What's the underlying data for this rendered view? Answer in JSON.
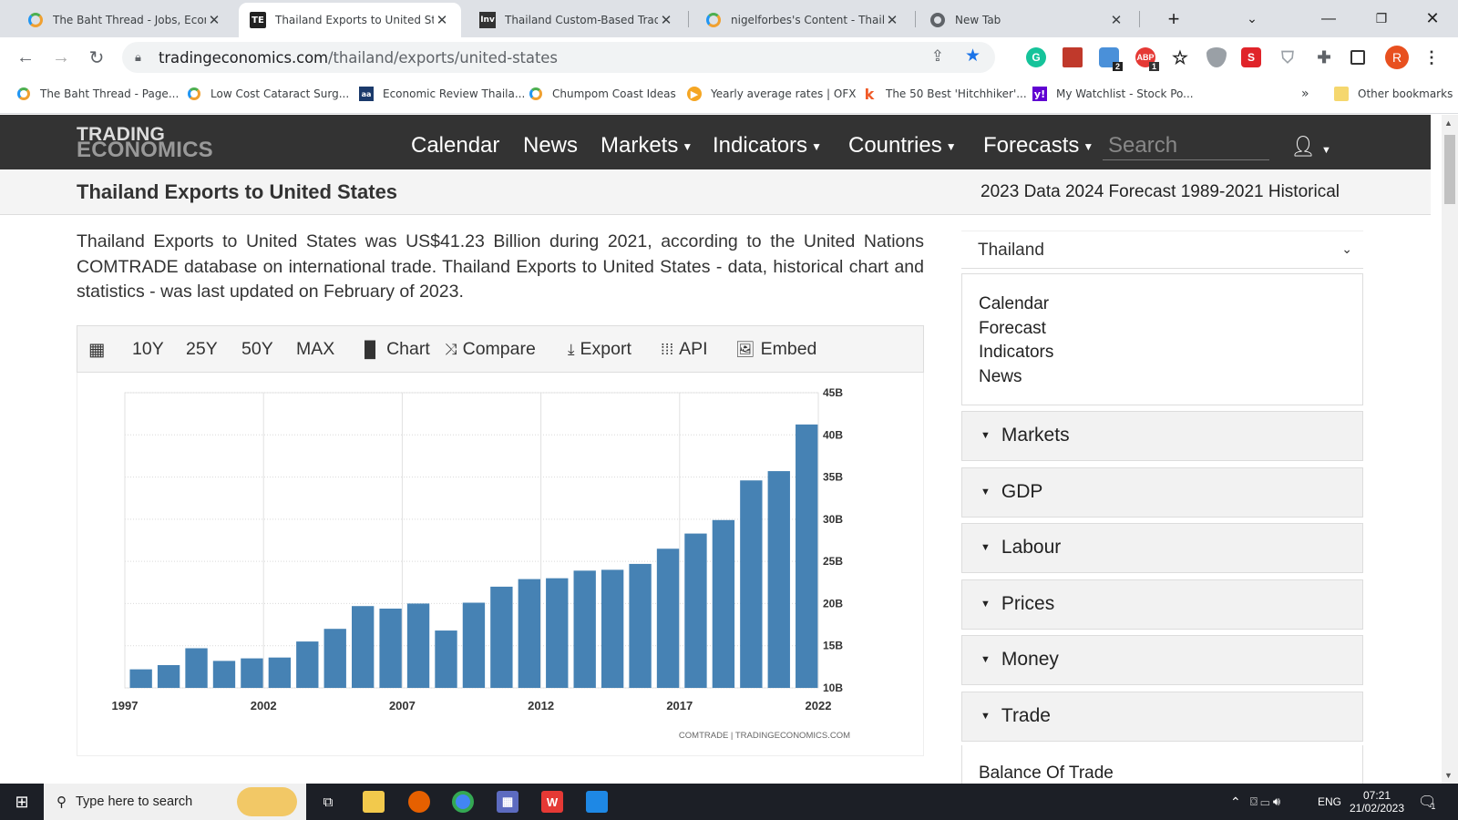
{
  "browser": {
    "tabs": [
      {
        "title": "The Baht Thread - Jobs, Econon",
        "icon": "ring-icon"
      },
      {
        "title": "Thailand Exports to United State",
        "icon": "te-icon"
      },
      {
        "title": "Thailand Custom-Based Trade D",
        "icon": "inv-icon"
      },
      {
        "title": "nigelforbes's Content - Thailand",
        "icon": "ring-icon"
      },
      {
        "title": "New Tab",
        "icon": "chrome-icon"
      }
    ],
    "url_domain": "tradingeconomics.com",
    "url_path": "/thailand/exports/united-states",
    "bookmarks": [
      "The Baht Thread - Page...",
      "Low Cost Cataract Surg...",
      "Economic Review Thaila...",
      "Chumpom Coast Ideas",
      "Yearly average rates | OFX",
      "The 50 Best 'Hitchhiker'...",
      "My Watchlist - Stock Po..."
    ],
    "other_bookmarks": "Other bookmarks",
    "more": "»",
    "profile_initial": "R",
    "badge_1": "2",
    "badge_2": "1",
    "adblock_label": "ABP"
  },
  "site": {
    "logo_line1": "TRADING",
    "logo_line2": "ECONOMICS",
    "nav": [
      "Calendar",
      "News",
      "Markets",
      "Indicators",
      "Countries",
      "Forecasts"
    ],
    "search_placeholder": "Search",
    "page_title": "Thailand Exports to United States",
    "sub_links": "2023 Data 2024 Forecast 1989-2021 Historical",
    "description": "Thailand Exports to United States was US$41.23 Billion during 2021, according to the United Nations COMTRADE database on international trade. Thailand Exports to United States - data, historical chart and statistics - was last updated on February of 2023.",
    "chart_toolbar": [
      "10Y",
      "25Y",
      "50Y",
      "MAX",
      "Chart",
      "Compare",
      "Export",
      "API",
      "Embed"
    ],
    "source_text": "COMTRADE | TRADINGECONOMICS.COM"
  },
  "sidebar": {
    "country": "Thailand",
    "links": [
      "Calendar",
      "Forecast",
      "Indicators",
      "News"
    ],
    "sections": [
      "Markets",
      "GDP",
      "Labour",
      "Prices",
      "Money",
      "Trade"
    ],
    "bottom_link": "Balance Of Trade"
  },
  "taskbar": {
    "search_placeholder": "Type here to search",
    "lang": "ENG",
    "time": "07:21",
    "date": "21/02/2023",
    "notif_count": "1"
  },
  "chart_data": {
    "type": "bar",
    "title": "",
    "xlabel": "",
    "ylabel": "",
    "x": [
      1997,
      1998,
      1999,
      2000,
      2001,
      2002,
      2003,
      2004,
      2005,
      2006,
      2007,
      2008,
      2009,
      2010,
      2011,
      2012,
      2013,
      2014,
      2015,
      2016,
      2017,
      2018,
      2019,
      2020,
      2021
    ],
    "values": [
      12.2,
      12.7,
      14.7,
      13.2,
      13.5,
      13.6,
      15.5,
      17.0,
      19.7,
      19.4,
      20.0,
      16.8,
      20.1,
      22.0,
      22.9,
      23.0,
      23.9,
      24.0,
      24.7,
      26.5,
      28.3,
      29.9,
      34.6,
      35.7,
      41.23
    ],
    "x_ticks": [
      "1997",
      "2002",
      "2007",
      "2012",
      "2017",
      "2022"
    ],
    "y_ticks": [
      "45B",
      "40B",
      "35B",
      "30B",
      "25B",
      "20B",
      "15B",
      "10B"
    ],
    "ylim": [
      10,
      45
    ],
    "xlim": [
      1997,
      2022
    ],
    "grid": true,
    "bar_color": "#4682b4"
  }
}
